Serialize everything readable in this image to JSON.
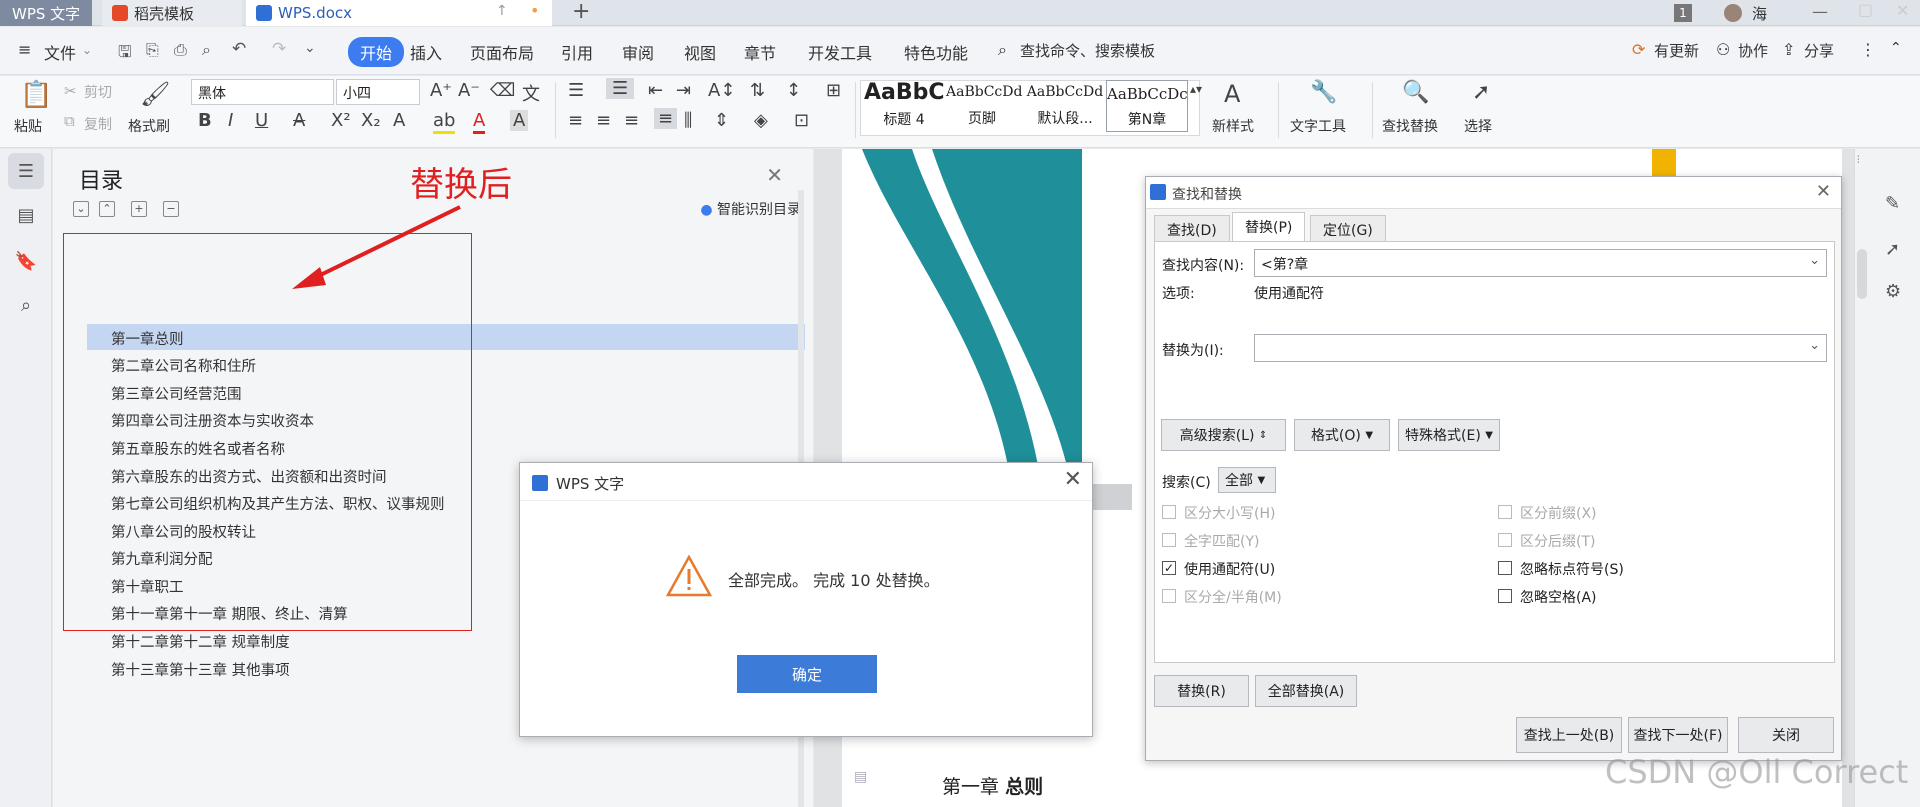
{
  "titlebar": {
    "app_tab": "WPS 文字",
    "tab2": "稻壳模板",
    "tab3": "WPS.docx",
    "new_tab": "+",
    "page_badge": "1",
    "user": "海"
  },
  "menubar": {
    "file": "文件",
    "items": [
      "开始",
      "插入",
      "页面布局",
      "引用",
      "审阅",
      "视图",
      "章节",
      "开发工具",
      "特色功能"
    ],
    "search": "查找命令、搜索模板",
    "update": "有更新",
    "collab": "协作",
    "share": "分享"
  },
  "toolbar": {
    "paste": "粘贴",
    "cut": "剪切",
    "copy": "复制",
    "format_painter": "格式刷",
    "font": "黑体",
    "size": "小四",
    "styles": [
      {
        "preview": "AaBbC",
        "label": "标题 4"
      },
      {
        "preview": "AaBbCcDd",
        "label": "页脚"
      },
      {
        "preview": "AaBbCcDd",
        "label": "默认段..."
      },
      {
        "preview": "AaBbCcDc",
        "label": "第N章"
      }
    ],
    "new_style": "新样式",
    "text_tools": "文字工具",
    "find_replace": "查找替换",
    "select": "选择"
  },
  "toc": {
    "title": "目录",
    "smart": "智能识别目录",
    "items": [
      "第一章总则",
      "第二章公司名称和住所",
      "第三章公司经营范围",
      "第四章公司注册资本与实收资本",
      "第五章股东的姓名或者名称",
      "第六章股东的出资方式、出资额和出资时间",
      "第七章公司组织机构及其产生方法、职权、议事规则",
      "第八章公司的股权转让",
      "第九章利润分配",
      "第十章职工",
      "第十一章第十一章  期限、终止、清算",
      "第十二章第十二章  规章制度",
      "第十三章第十三章  其他事项"
    ]
  },
  "annotation": "替换后",
  "document": {
    "heading_num": "第一章",
    "heading_text": "总则"
  },
  "find_replace": {
    "title": "查找和替换",
    "tabs": [
      "查找(D)",
      "替换(P)",
      "定位(G)"
    ],
    "find_label": "查找内容(N):",
    "find_value": "<第?章",
    "options_label": "选项:",
    "options_value": "使用通配符",
    "replace_label": "替换为(I):",
    "replace_value": "",
    "advanced": "高级搜索(L)",
    "format": "格式(O)",
    "special": "特殊格式(E)",
    "search_label": "搜索(C)",
    "search_scope": "全部",
    "checks": [
      {
        "label": "区分大小写(H)",
        "checked": false,
        "enabled": false
      },
      {
        "label": "全字匹配(Y)",
        "checked": false,
        "enabled": false
      },
      {
        "label": "使用通配符(U)",
        "checked": true,
        "enabled": true
      },
      {
        "label": "区分全/半角(M)",
        "checked": false,
        "enabled": false
      },
      {
        "label": "区分前缀(X)",
        "checked": false,
        "enabled": false
      },
      {
        "label": "区分后缀(T)",
        "checked": false,
        "enabled": false
      },
      {
        "label": "忽略标点符号(S)",
        "checked": false,
        "enabled": true
      },
      {
        "label": "忽略空格(A)",
        "checked": false,
        "enabled": true
      }
    ],
    "replace_btn": "替换(R)",
    "replace_all_btn": "全部替换(A)",
    "find_prev": "查找上一处(B)",
    "find_next": "查找下一处(F)",
    "close": "关闭"
  },
  "wps_dialog": {
    "title": "WPS 文字",
    "message": "全部完成。 完成 10 处替换。",
    "ok": "确定"
  },
  "watermark": "CSDN @Oll Correct",
  "colors": {
    "accent": "#3c7bf0",
    "annotation_red": "#e02020",
    "teal": "#1f8f99",
    "toc_highlight": "#c4d6f2"
  }
}
